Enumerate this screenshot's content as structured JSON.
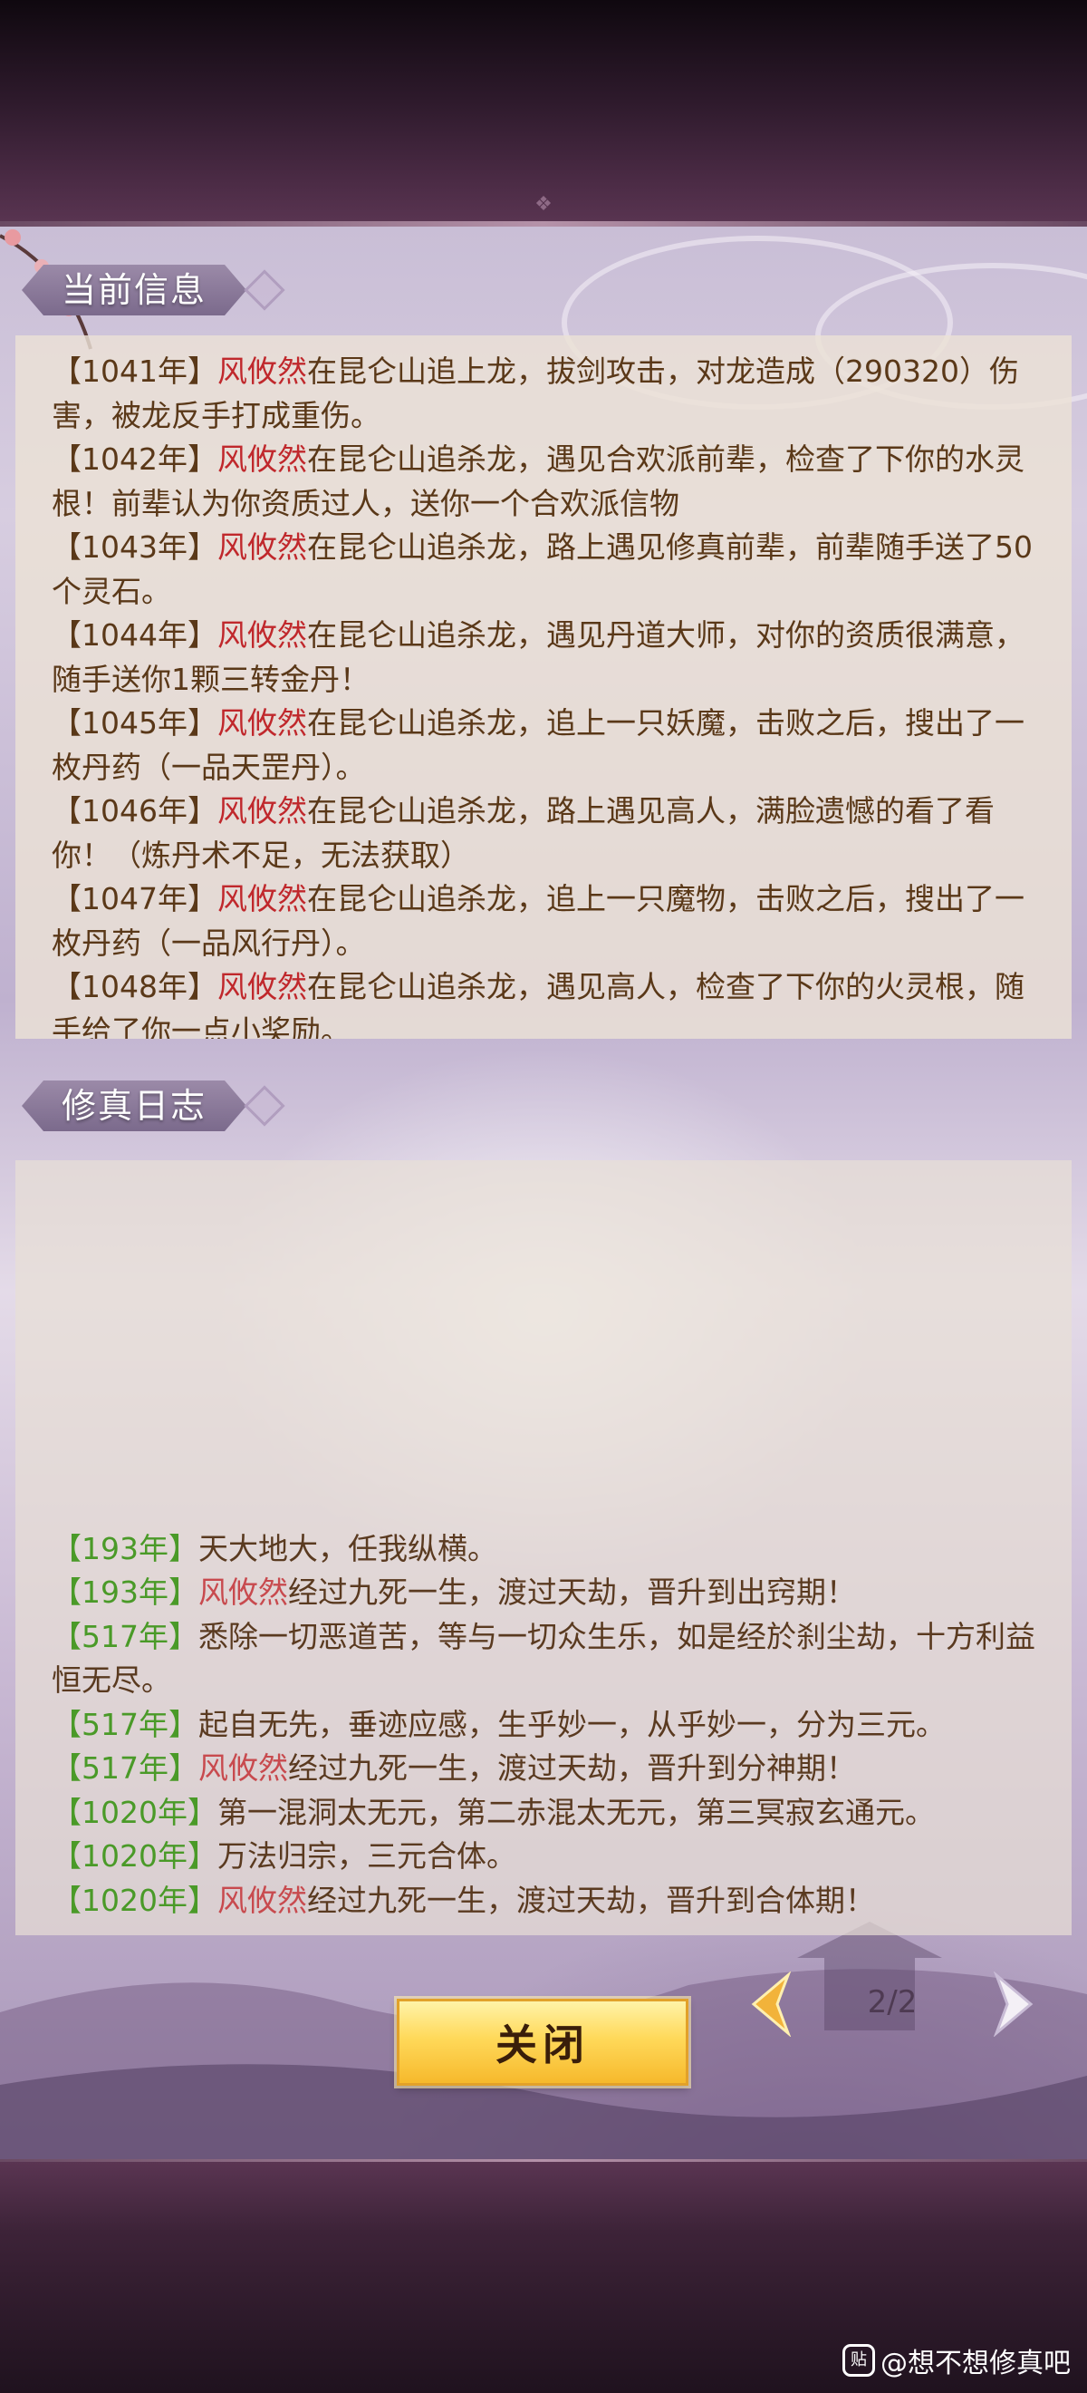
{
  "info_section": {
    "title": "当前信息",
    "entries": [
      {
        "year": "【1041年】",
        "name": "风攸然",
        "text": "在昆仑山追上龙，拔剑攻击，对龙造成（290320）伤害，被龙反手打成重伤。"
      },
      {
        "year": "【1042年】",
        "name": "风攸然",
        "text": "在昆仑山追杀龙，遇见合欢派前辈，检查了下你的水灵根！前辈认为你资质过人，送你一个合欢派信物"
      },
      {
        "year": "【1043年】",
        "name": "风攸然",
        "text": "在昆仑山追杀龙，路上遇见修真前辈，前辈随手送了50个灵石。"
      },
      {
        "year": "【1044年】",
        "name": "风攸然",
        "text": "在昆仑山追杀龙，遇见丹道大师，对你的资质很满意，随手送你1颗三转金丹！"
      },
      {
        "year": "【1045年】",
        "name": "风攸然",
        "text": "在昆仑山追杀龙，追上一只妖魔，击败之后，搜出了一枚丹药（一品天罡丹）。"
      },
      {
        "year": "【1046年】",
        "name": "风攸然",
        "text": "在昆仑山追杀龙，路上遇见高人，满脸遗憾的看了看你！（炼丹术不足，无法获取）"
      },
      {
        "year": "【1047年】",
        "name": "风攸然",
        "text": "在昆仑山追杀龙，追上一只魔物，击败之后，搜出了一枚丹药（一品风行丹）。"
      },
      {
        "year": "【1048年】",
        "name": "风攸然",
        "text": "在昆仑山追杀龙，遇见高人，检查了下你的火灵根，随手给了你一点小奖励。"
      }
    ]
  },
  "log_section": {
    "title": "修真日志",
    "entries": [
      {
        "year": "【193年】",
        "name": "",
        "text": "天大地大，任我纵横。"
      },
      {
        "year": "【193年】",
        "name": "风攸然",
        "text": "经过九死一生，渡过天劫，晋升到出窍期！"
      },
      {
        "year": "【517年】",
        "name": "",
        "text": "悉除一切恶道苦，等与一切众生乐，如是经於刹尘劫，十方利益恒无尽。"
      },
      {
        "year": "【517年】",
        "name": "",
        "text": "起自无先，垂迹应感，生乎妙一，从乎妙一，分为三元。"
      },
      {
        "year": "【517年】",
        "name": "风攸然",
        "text": "经过九死一生，渡过天劫，晋升到分神期！"
      },
      {
        "year": "【1020年】",
        "name": "",
        "text": "第一混洞太无元，第二赤混太无元，第三冥寂玄通元。"
      },
      {
        "year": "【1020年】",
        "name": "",
        "text": "万法归宗，三元合体。"
      },
      {
        "year": "【1020年】",
        "name": "风攸然",
        "text": "经过九死一生，渡过天劫，晋升到合体期！"
      }
    ]
  },
  "controls": {
    "close_label": "关闭",
    "page_indicator": "2/2"
  },
  "watermark": {
    "badge": "贴",
    "text": "@想不想修真吧"
  },
  "colors": {
    "name_red": "#c0282c",
    "log_year_green": "#4a9a28",
    "entry_brown": "#5a3818",
    "button_gold": "#ffd95a"
  }
}
